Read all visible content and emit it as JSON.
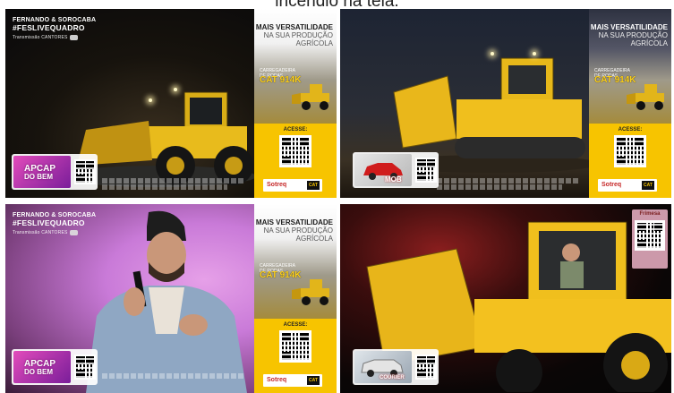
{
  "caption": "incêndio na tela.",
  "overlay": {
    "brand_line1": "FERNANDO & SOROCABA",
    "brand_hashtag": "#FESLIVEQUADRO",
    "brand_live": "Transmissão CANTORES"
  },
  "sidebar_ad": {
    "headline_bold": "MAIS VERSATILIDADE",
    "headline_rest": "NA SUA PRODUÇÃO AGRÍCOLA",
    "product_badge": "CARREGADEIRA DE RODAS",
    "product_name": "CAT 914K",
    "access_label": "ACESSE:",
    "dealer": "Sotreq",
    "maker": "CAT"
  },
  "promos": [
    {
      "label_top": "APCAP",
      "label_bottom": "DO BEM"
    },
    {
      "label_top": "MOB",
      "label_bottom": ""
    },
    {
      "label_top": "APCAP",
      "label_bottom": "DO BEM"
    },
    {
      "label_top": "COURIER",
      "label_bottom": ""
    }
  ],
  "panel4_badge": "Frimesa",
  "colors": {
    "cat_yellow": "#f7c400",
    "sotreq_red": "#c62828",
    "apcap_pink": "#d21ea0"
  }
}
